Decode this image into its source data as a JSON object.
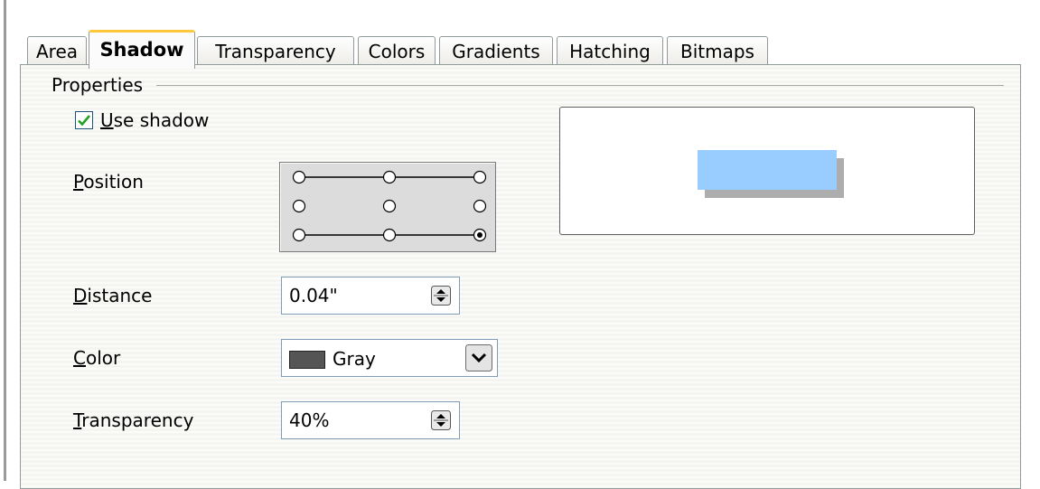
{
  "tabs": [
    {
      "label": "Area",
      "active": false
    },
    {
      "label": "Shadow",
      "active": true
    },
    {
      "label": "Transparency",
      "active": false
    },
    {
      "label": "Colors",
      "active": false
    },
    {
      "label": "Gradients",
      "active": false
    },
    {
      "label": "Hatching",
      "active": false
    },
    {
      "label": "Bitmaps",
      "active": false
    }
  ],
  "properties": {
    "group_title": "Properties",
    "use_shadow": {
      "label_first": "U",
      "label_rest": "se shadow",
      "checked": true
    },
    "position": {
      "label_first": "P",
      "label_rest": "osition",
      "selected": "bottom-right"
    },
    "distance": {
      "label_first": "D",
      "label_rest": "istance",
      "value": "0.04\""
    },
    "color": {
      "label_first": "C",
      "label_rest": "olor",
      "value": "Gray",
      "swatch": "#555555"
    },
    "transparency": {
      "label_first": "T",
      "label_rest": "ransparency",
      "value": "40%"
    }
  },
  "preview": {
    "object_color": "#99ccff",
    "shadow_color": "#adadad"
  }
}
